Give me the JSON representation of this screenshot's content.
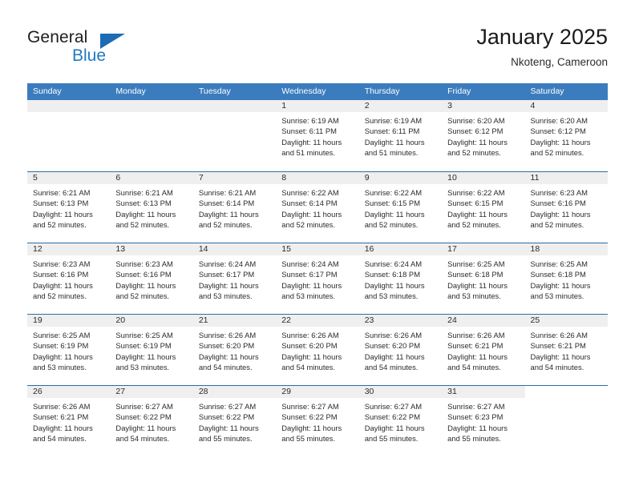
{
  "brand": {
    "name_part1": "General",
    "name_part2": "Blue",
    "triangle_color": "#1b6cb5",
    "blue_color": "#2179c4"
  },
  "header": {
    "title": "January 2025",
    "subtitle": "Nkoteng, Cameroon"
  },
  "theme": {
    "header_row_bg": "#3b7cbe",
    "week_divider": "#2c6ca8",
    "daynum_band_bg": "#efefef",
    "text": "#2b2b2b"
  },
  "weekdays": [
    "Sunday",
    "Monday",
    "Tuesday",
    "Wednesday",
    "Thursday",
    "Friday",
    "Saturday"
  ],
  "weeks": [
    [
      {
        "day": "",
        "blank": true
      },
      {
        "day": "",
        "blank": true
      },
      {
        "day": "",
        "blank": true
      },
      {
        "day": "1",
        "sunrise": "Sunrise: 6:19 AM",
        "sunset": "Sunset: 6:11 PM",
        "daylight1": "Daylight: 11 hours",
        "daylight2": "and 51 minutes."
      },
      {
        "day": "2",
        "sunrise": "Sunrise: 6:19 AM",
        "sunset": "Sunset: 6:11 PM",
        "daylight1": "Daylight: 11 hours",
        "daylight2": "and 51 minutes."
      },
      {
        "day": "3",
        "sunrise": "Sunrise: 6:20 AM",
        "sunset": "Sunset: 6:12 PM",
        "daylight1": "Daylight: 11 hours",
        "daylight2": "and 52 minutes."
      },
      {
        "day": "4",
        "sunrise": "Sunrise: 6:20 AM",
        "sunset": "Sunset: 6:12 PM",
        "daylight1": "Daylight: 11 hours",
        "daylight2": "and 52 minutes."
      }
    ],
    [
      {
        "day": "5",
        "sunrise": "Sunrise: 6:21 AM",
        "sunset": "Sunset: 6:13 PM",
        "daylight1": "Daylight: 11 hours",
        "daylight2": "and 52 minutes."
      },
      {
        "day": "6",
        "sunrise": "Sunrise: 6:21 AM",
        "sunset": "Sunset: 6:13 PM",
        "daylight1": "Daylight: 11 hours",
        "daylight2": "and 52 minutes."
      },
      {
        "day": "7",
        "sunrise": "Sunrise: 6:21 AM",
        "sunset": "Sunset: 6:14 PM",
        "daylight1": "Daylight: 11 hours",
        "daylight2": "and 52 minutes."
      },
      {
        "day": "8",
        "sunrise": "Sunrise: 6:22 AM",
        "sunset": "Sunset: 6:14 PM",
        "daylight1": "Daylight: 11 hours",
        "daylight2": "and 52 minutes."
      },
      {
        "day": "9",
        "sunrise": "Sunrise: 6:22 AM",
        "sunset": "Sunset: 6:15 PM",
        "daylight1": "Daylight: 11 hours",
        "daylight2": "and 52 minutes."
      },
      {
        "day": "10",
        "sunrise": "Sunrise: 6:22 AM",
        "sunset": "Sunset: 6:15 PM",
        "daylight1": "Daylight: 11 hours",
        "daylight2": "and 52 minutes."
      },
      {
        "day": "11",
        "sunrise": "Sunrise: 6:23 AM",
        "sunset": "Sunset: 6:16 PM",
        "daylight1": "Daylight: 11 hours",
        "daylight2": "and 52 minutes."
      }
    ],
    [
      {
        "day": "12",
        "sunrise": "Sunrise: 6:23 AM",
        "sunset": "Sunset: 6:16 PM",
        "daylight1": "Daylight: 11 hours",
        "daylight2": "and 52 minutes."
      },
      {
        "day": "13",
        "sunrise": "Sunrise: 6:23 AM",
        "sunset": "Sunset: 6:16 PM",
        "daylight1": "Daylight: 11 hours",
        "daylight2": "and 52 minutes."
      },
      {
        "day": "14",
        "sunrise": "Sunrise: 6:24 AM",
        "sunset": "Sunset: 6:17 PM",
        "daylight1": "Daylight: 11 hours",
        "daylight2": "and 53 minutes."
      },
      {
        "day": "15",
        "sunrise": "Sunrise: 6:24 AM",
        "sunset": "Sunset: 6:17 PM",
        "daylight1": "Daylight: 11 hours",
        "daylight2": "and 53 minutes."
      },
      {
        "day": "16",
        "sunrise": "Sunrise: 6:24 AM",
        "sunset": "Sunset: 6:18 PM",
        "daylight1": "Daylight: 11 hours",
        "daylight2": "and 53 minutes."
      },
      {
        "day": "17",
        "sunrise": "Sunrise: 6:25 AM",
        "sunset": "Sunset: 6:18 PM",
        "daylight1": "Daylight: 11 hours",
        "daylight2": "and 53 minutes."
      },
      {
        "day": "18",
        "sunrise": "Sunrise: 6:25 AM",
        "sunset": "Sunset: 6:18 PM",
        "daylight1": "Daylight: 11 hours",
        "daylight2": "and 53 minutes."
      }
    ],
    [
      {
        "day": "19",
        "sunrise": "Sunrise: 6:25 AM",
        "sunset": "Sunset: 6:19 PM",
        "daylight1": "Daylight: 11 hours",
        "daylight2": "and 53 minutes."
      },
      {
        "day": "20",
        "sunrise": "Sunrise: 6:25 AM",
        "sunset": "Sunset: 6:19 PM",
        "daylight1": "Daylight: 11 hours",
        "daylight2": "and 53 minutes."
      },
      {
        "day": "21",
        "sunrise": "Sunrise: 6:26 AM",
        "sunset": "Sunset: 6:20 PM",
        "daylight1": "Daylight: 11 hours",
        "daylight2": "and 54 minutes."
      },
      {
        "day": "22",
        "sunrise": "Sunrise: 6:26 AM",
        "sunset": "Sunset: 6:20 PM",
        "daylight1": "Daylight: 11 hours",
        "daylight2": "and 54 minutes."
      },
      {
        "day": "23",
        "sunrise": "Sunrise: 6:26 AM",
        "sunset": "Sunset: 6:20 PM",
        "daylight1": "Daylight: 11 hours",
        "daylight2": "and 54 minutes."
      },
      {
        "day": "24",
        "sunrise": "Sunrise: 6:26 AM",
        "sunset": "Sunset: 6:21 PM",
        "daylight1": "Daylight: 11 hours",
        "daylight2": "and 54 minutes."
      },
      {
        "day": "25",
        "sunrise": "Sunrise: 6:26 AM",
        "sunset": "Sunset: 6:21 PM",
        "daylight1": "Daylight: 11 hours",
        "daylight2": "and 54 minutes."
      }
    ],
    [
      {
        "day": "26",
        "sunrise": "Sunrise: 6:26 AM",
        "sunset": "Sunset: 6:21 PM",
        "daylight1": "Daylight: 11 hours",
        "daylight2": "and 54 minutes."
      },
      {
        "day": "27",
        "sunrise": "Sunrise: 6:27 AM",
        "sunset": "Sunset: 6:22 PM",
        "daylight1": "Daylight: 11 hours",
        "daylight2": "and 54 minutes."
      },
      {
        "day": "28",
        "sunrise": "Sunrise: 6:27 AM",
        "sunset": "Sunset: 6:22 PM",
        "daylight1": "Daylight: 11 hours",
        "daylight2": "and 55 minutes."
      },
      {
        "day": "29",
        "sunrise": "Sunrise: 6:27 AM",
        "sunset": "Sunset: 6:22 PM",
        "daylight1": "Daylight: 11 hours",
        "daylight2": "and 55 minutes."
      },
      {
        "day": "30",
        "sunrise": "Sunrise: 6:27 AM",
        "sunset": "Sunset: 6:22 PM",
        "daylight1": "Daylight: 11 hours",
        "daylight2": "and 55 minutes."
      },
      {
        "day": "31",
        "sunrise": "Sunrise: 6:27 AM",
        "sunset": "Sunset: 6:23 PM",
        "daylight1": "Daylight: 11 hours",
        "daylight2": "and 55 minutes."
      },
      {
        "day": "",
        "blank": true,
        "nopad": true
      }
    ]
  ]
}
